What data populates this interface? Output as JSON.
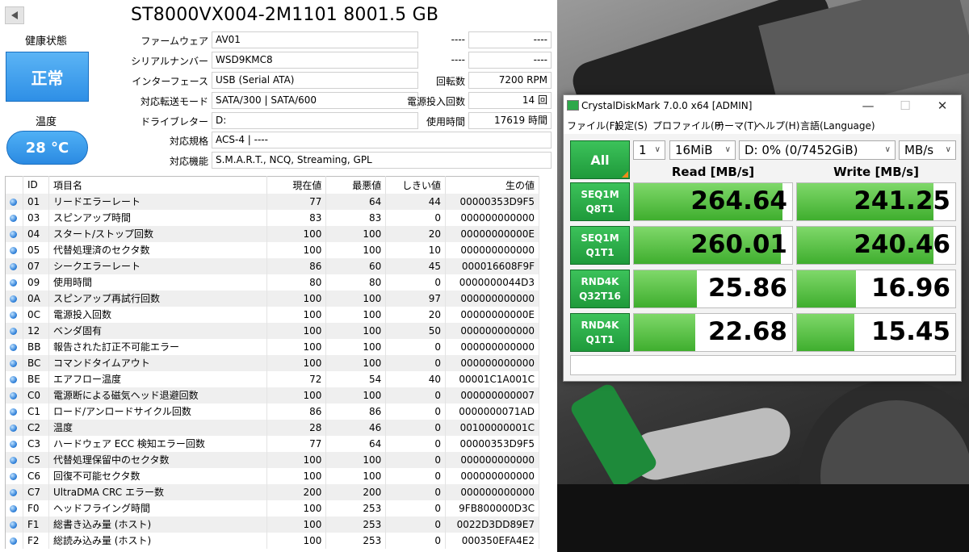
{
  "cdi": {
    "title": "ST8000VX004-2M1101 8001.5 GB",
    "health_label": "健康状態",
    "health_value": "正常",
    "temp_label": "温度",
    "temp_value": "28 °C",
    "firmware_label": "ファームウェア",
    "firmware": "AV01",
    "serial_label": "シリアルナンバー",
    "serial": "WSD9KMC8",
    "interface_label": "インターフェース",
    "interface": "USB (Serial ATA)",
    "transfer_label": "対応転送モード",
    "transfer": "SATA/300 | SATA/600",
    "drive_letter_label": "ドライブレター",
    "drive_letter": "D:",
    "standard_label": "対応規格",
    "standard": "ACS-4 | ----",
    "features_label": "対応機能",
    "features": "S.M.A.R.T., NCQ, Streaming, GPL",
    "blank_label_1": "----",
    "blank_value_1": "----",
    "blank_label_2": "----",
    "blank_value_2": "----",
    "rpm_label": "回転数",
    "rpm": "7200 RPM",
    "power_count_label": "電源投入回数",
    "power_count": "14 回",
    "hours_label": "使用時間",
    "hours": "17619 時間",
    "table_headers": [
      "ID",
      "項目名",
      "現在値",
      "最悪値",
      "しきい値",
      "生の値"
    ],
    "smart": [
      [
        "01",
        "リードエラーレート",
        "77",
        "64",
        "44",
        "00000353D9F5"
      ],
      [
        "03",
        "スピンアップ時間",
        "83",
        "83",
        "0",
        "000000000000"
      ],
      [
        "04",
        "スタート/ストップ回数",
        "100",
        "100",
        "20",
        "00000000000E"
      ],
      [
        "05",
        "代替処理済のセクタ数",
        "100",
        "100",
        "10",
        "000000000000"
      ],
      [
        "07",
        "シークエラーレート",
        "86",
        "60",
        "45",
        "000016608F9F"
      ],
      [
        "09",
        "使用時間",
        "80",
        "80",
        "0",
        "0000000044D3"
      ],
      [
        "0A",
        "スピンアップ再試行回数",
        "100",
        "100",
        "97",
        "000000000000"
      ],
      [
        "0C",
        "電源投入回数",
        "100",
        "100",
        "20",
        "00000000000E"
      ],
      [
        "12",
        "ベンダ固有",
        "100",
        "100",
        "50",
        "000000000000"
      ],
      [
        "BB",
        "報告された訂正不可能エラー",
        "100",
        "100",
        "0",
        "000000000000"
      ],
      [
        "BC",
        "コマンドタイムアウト",
        "100",
        "100",
        "0",
        "000000000000"
      ],
      [
        "BE",
        "エアフロー温度",
        "72",
        "54",
        "40",
        "00001C1A001C"
      ],
      [
        "C0",
        "電源断による磁気ヘッド退避回数",
        "100",
        "100",
        "0",
        "000000000007"
      ],
      [
        "C1",
        "ロード/アンロードサイクル回数",
        "86",
        "86",
        "0",
        "0000000071AD"
      ],
      [
        "C2",
        "温度",
        "28",
        "46",
        "0",
        "00100000001C"
      ],
      [
        "C3",
        "ハードウェア ECC 検知エラー回数",
        "77",
        "64",
        "0",
        "00000353D9F5"
      ],
      [
        "C5",
        "代替処理保留中のセクタ数",
        "100",
        "100",
        "0",
        "000000000000"
      ],
      [
        "C6",
        "回復不可能セクタ数",
        "100",
        "100",
        "0",
        "000000000000"
      ],
      [
        "C7",
        "UltraDMA CRC エラー数",
        "200",
        "200",
        "0",
        "000000000000"
      ],
      [
        "F0",
        "ヘッドフライング時間",
        "100",
        "253",
        "0",
        "9FB800000D3C"
      ],
      [
        "F1",
        "総書き込み量 (ホスト)",
        "100",
        "253",
        "0",
        "0022D3DD89E7"
      ],
      [
        "F2",
        "総読み込み量 (ホスト)",
        "100",
        "253",
        "0",
        "000350EFA4E2"
      ]
    ]
  },
  "cdm": {
    "title": "CrystalDiskMark 7.0.0 x64 [ADMIN]",
    "menu": [
      "ファイル(F)",
      "設定(S)",
      "プロファイル(P)",
      "テーマ(T)",
      "ヘルプ(H)",
      "言語(Language)"
    ],
    "all_label": "All",
    "count": "1",
    "size": "16MiB",
    "drive": "D: 0% (0/7452GiB)",
    "unit": "MB/s",
    "read_header": "Read [MB/s]",
    "write_header": "Write [MB/s]",
    "tests": [
      {
        "line1": "SEQ1M",
        "line2": "Q8T1",
        "read": "264.64",
        "write": "241.25",
        "read_fill": 0.94,
        "write_fill": 0.86
      },
      {
        "line1": "SEQ1M",
        "line2": "Q1T1",
        "read": "260.01",
        "write": "240.46",
        "read_fill": 0.93,
        "write_fill": 0.86
      },
      {
        "line1": "RND4K",
        "line2": "Q32T16",
        "read": "25.86",
        "write": "16.96",
        "read_fill": 0.4,
        "write_fill": 0.37
      },
      {
        "line1": "RND4K",
        "line2": "Q1T1",
        "read": "22.68",
        "write": "15.45",
        "read_fill": 0.39,
        "write_fill": 0.36
      }
    ]
  }
}
